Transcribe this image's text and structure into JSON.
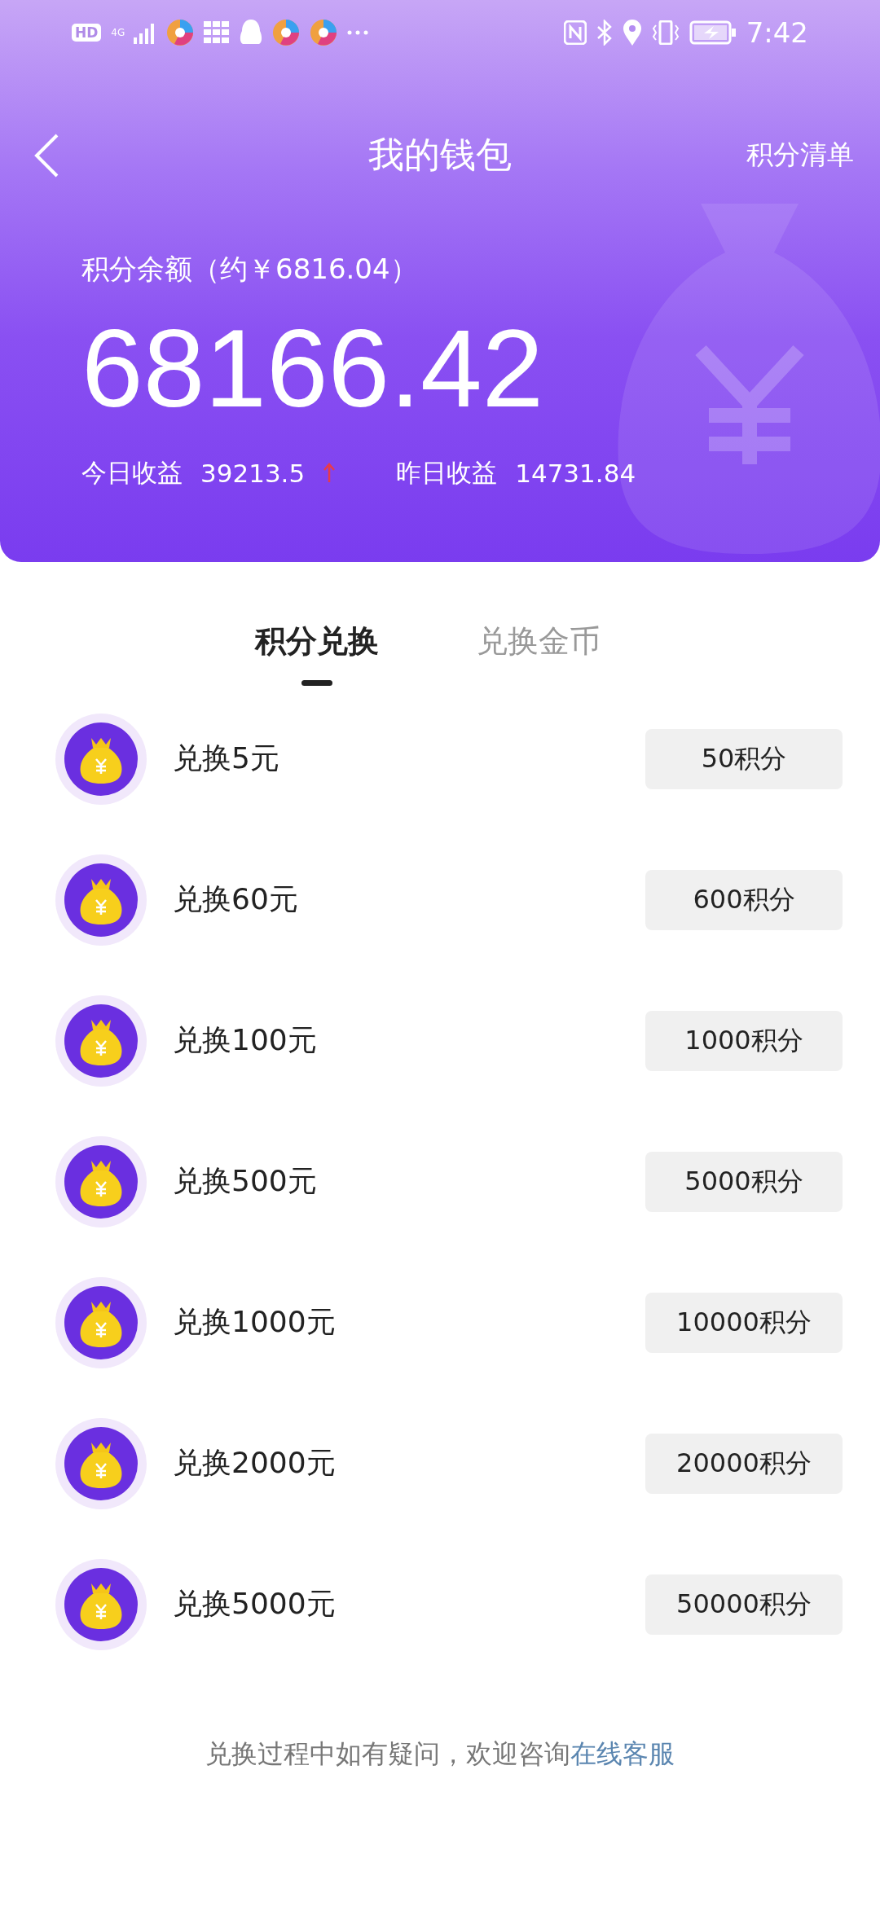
{
  "status_bar": {
    "hd": "HD",
    "network": "4G",
    "time": "7:42"
  },
  "header": {
    "title": "我的钱包",
    "action": "积分清单"
  },
  "balance": {
    "label": "积分余额（约￥6816.04）",
    "value": "68166.42"
  },
  "stats": [
    {
      "label": "今日收益",
      "value": "39213.5",
      "rising": true
    },
    {
      "label": "昨日收益",
      "value": "14731.84",
      "rising": false
    }
  ],
  "tabs": [
    {
      "label": "积分兑换",
      "selected": true
    },
    {
      "label": "兑换金币",
      "selected": false
    }
  ],
  "items": [
    {
      "title": "兑换5元",
      "price": "50积分"
    },
    {
      "title": "兑换60元",
      "price": "600积分"
    },
    {
      "title": "兑换100元",
      "price": "1000积分"
    },
    {
      "title": "兑换500元",
      "price": "5000积分"
    },
    {
      "title": "兑换1000元",
      "price": "10000积分"
    },
    {
      "title": "兑换2000元",
      "price": "20000积分"
    },
    {
      "title": "兑换5000元",
      "price": "50000积分"
    }
  ],
  "footer": {
    "text": "兑换过程中如有疑问，欢迎咨询",
    "link": "在线客服"
  }
}
